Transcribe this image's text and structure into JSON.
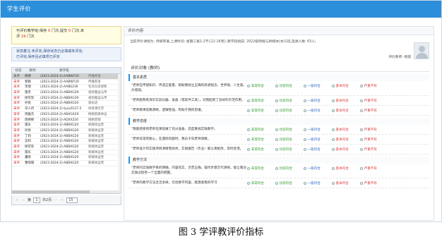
{
  "app": {
    "title": "学生评价"
  },
  "notice": {
    "line1_prefix": "可评价教学班:保存",
    "saved": "0",
    "line1_mid": "门次,提交",
    "submitted": "0",
    "line1_suffix": "门次,未",
    "line2_prefix": "评",
    "unevaluated": "19",
    "line2_suffix": "门次"
  },
  "legend": {
    "line1": "状态着注:未评完,保存状态已必填或未评完;",
    "line2": "已评完,保存且必填项已评完"
  },
  "grid": {
    "columns": [
      "状态",
      "教师",
      "教学班",
      ""
    ],
    "rows": [
      {
        "status": "未评",
        "teacher": "杨建",
        "class": "(2023-2024-2)-AABWY20",
        "course": "传播英语",
        "selected": true
      },
      {
        "status": "未评",
        "teacher": "郭颖",
        "class": "(2023-2024-2)-AABWY20",
        "course": "传播英语",
        "selected": false
      },
      {
        "status": "未评",
        "teacher": "李朋",
        "class": "(2023-2024-2)-AABS230",
        "course": "毛泽东思想和",
        "selected": false
      },
      {
        "status": "未评",
        "teacher": "雷月",
        "class": "(2023-2024-2)-ABBXG39",
        "course": "视觉搬运与传",
        "selected": false
      },
      {
        "status": "未评",
        "teacher": "杨可欣",
        "class": "(2023-2024-2)-ABBXG39",
        "course": "视觉搬运与传",
        "selected": false
      },
      {
        "status": "未评",
        "teacher": "孙悦",
        "class": "(2023-2024-2)-ABBXG20",
        "course": "现标语",
        "selected": false
      },
      {
        "status": "未评",
        "teacher": "邓人月",
        "class": "(2023-2024-2)-tyxx0137-2",
        "course": "体育课示范",
        "selected": false
      },
      {
        "status": "未评",
        "teacher": "周雅杰",
        "class": "(2023-2024-2)-ABXGX29",
        "course": "网络新媒体运",
        "selected": false
      },
      {
        "status": "未评",
        "teacher": "周婷婷",
        "class": "(2023-2024-2)-ADXX220",
        "course": "网络营销",
        "selected": false
      },
      {
        "status": "未评",
        "teacher": "雷乐",
        "class": "(2023-2024-2)-ABBXG20",
        "course": "新媒体运营",
        "selected": false
      },
      {
        "status": "未评",
        "teacher": "孙悦",
        "class": "(2023-2024-2)-ABBXG20",
        "course": "新媒体运营",
        "selected": false
      },
      {
        "status": "未评",
        "teacher": "丁莉",
        "class": "(2023-2024-2)-ABBXG20",
        "course": "新媒体运营",
        "selected": false
      },
      {
        "status": "未评",
        "teacher": "音莉",
        "class": "(2023-2024-2)-ABBXG20",
        "course": "新媒体运营",
        "selected": false
      },
      {
        "status": "未评",
        "teacher": "杨可欣",
        "class": "(2023-2024-2)-ABBXG20",
        "course": "新媒体运营",
        "selected": false
      },
      {
        "status": "未评",
        "teacher": "雷乐",
        "class": "(2023-2024-2)-ABBXG20",
        "course": "新媒体运营",
        "selected": false
      },
      {
        "status": "未评",
        "teacher": "董晓",
        "class": "(2023-2024-2)-ABBXG20",
        "course": "新媒体运营",
        "selected": false
      },
      {
        "status": "未评",
        "teacher": "曹晓璐",
        "class": "(2023-2024-2)-ABBXG20",
        "course": "新媒体运营",
        "selected": false
      }
    ]
  },
  "pager": {
    "first": "«",
    "prev": "‹",
    "page_prefix": "第",
    "page": "1",
    "page_suffix": "共2页",
    "next": "›",
    "last": "»",
    "page_size": "15"
  },
  "right": {
    "header": "评价内容",
    "info_line": "当前评价课程为: 传媒英语,上课时间: 星期三第1-2节{12-16周},教学班组成: 2022级网络与新媒体(本)1班,选课人数: 63人;",
    "teacher_label": "评价教师: 杨建",
    "section_title": "评价对象 (教师)",
    "options": [
      "非常符合",
      "比较符合",
      "一般符合",
      "基本符合",
      "严重不符"
    ],
    "categories": [
      {
        "name": "基本素质",
        "questions": [
          "\"老师在传授知识、传递正能量、帮助我树立正确的思想观念、世界观、人生观、价值观。",
          "\"老师能熟练演示实验仪器、设备（或软件工具），对我起到了良好的示范作用。",
          "\"老师教课思路清晰，逻辑性强，有助于我的思维。"
        ]
      },
      {
        "name": "教学态度",
        "questions": [
          "\"我能感受到老师在课前做了充分准备，态度重视实践教学。",
          "\"老师非常有耐心，在遇到问题时，我乐于向老师请教。",
          "\"老师设计的实践项目清晰而具体，实践报告（作业）能认真批改，及时反馈。"
        ]
      },
      {
        "name": "教学方法",
        "questions": [
          "\"老师的实践教学目的明确、内容充实、示范正确，操作步骤交代清晰，能让我对实践过程有一个全面的把握。",
          "\"老师的教学方法灵活多样，切合教学内容，能激发我的学习"
        ]
      }
    ]
  },
  "caption": "图 3  学评教评价指标"
}
